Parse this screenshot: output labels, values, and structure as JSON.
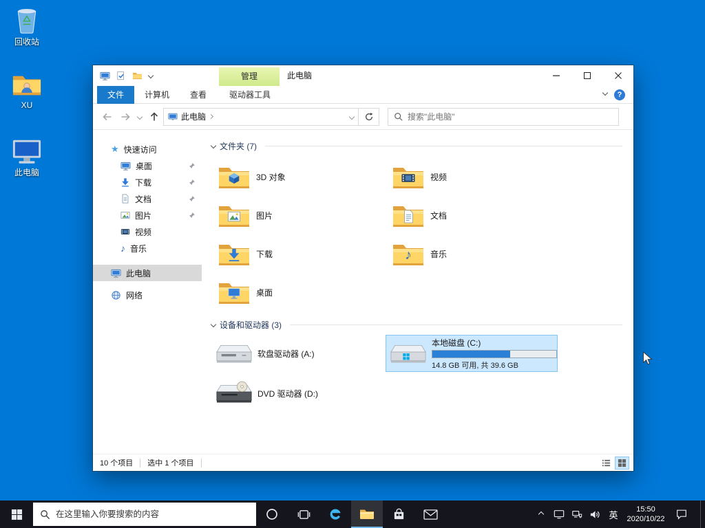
{
  "desktop": {
    "icons": [
      {
        "label": "回收站"
      },
      {
        "label": "XU"
      },
      {
        "label": "此电脑"
      }
    ]
  },
  "explorer": {
    "title": "此电脑",
    "contextual_group": "管理",
    "tabs": {
      "file": "文件",
      "computer": "计算机",
      "view": "查看",
      "drive_tools": "驱动器工具"
    },
    "help_label": "?",
    "address": "此电脑",
    "search_placeholder": "搜索\"此电脑\"",
    "sidebar": {
      "quick_access": "快速访问",
      "items": [
        {
          "label": "桌面"
        },
        {
          "label": "下载"
        },
        {
          "label": "文档"
        },
        {
          "label": "图片"
        },
        {
          "label": "视频"
        },
        {
          "label": "音乐"
        }
      ],
      "this_pc": "此电脑",
      "network": "网络"
    },
    "content": {
      "folders_header": "文件夹 (7)",
      "folders": [
        {
          "label": "3D 对象"
        },
        {
          "label": "图片"
        },
        {
          "label": "下载"
        },
        {
          "label": "桌面"
        },
        {
          "label": "视频"
        },
        {
          "label": "文档"
        },
        {
          "label": "音乐"
        }
      ],
      "devices_header": "设备和驱动器 (3)",
      "drives": {
        "floppy": {
          "label": "软盘驱动器 (A:)"
        },
        "c": {
          "label": "本地磁盘 (C:)",
          "detail": "14.8 GB 可用, 共 39.6 GB",
          "used_percent": 63
        },
        "dvd": {
          "label": "DVD 驱动器 (D:)"
        }
      }
    },
    "statusbar": {
      "items": "10 个项目",
      "selected": "选中 1 个项目"
    }
  },
  "taskbar": {
    "search_placeholder": "在这里输入你要搜索的内容",
    "ime": "英",
    "time": "15:50",
    "date": "2020/10/22"
  }
}
